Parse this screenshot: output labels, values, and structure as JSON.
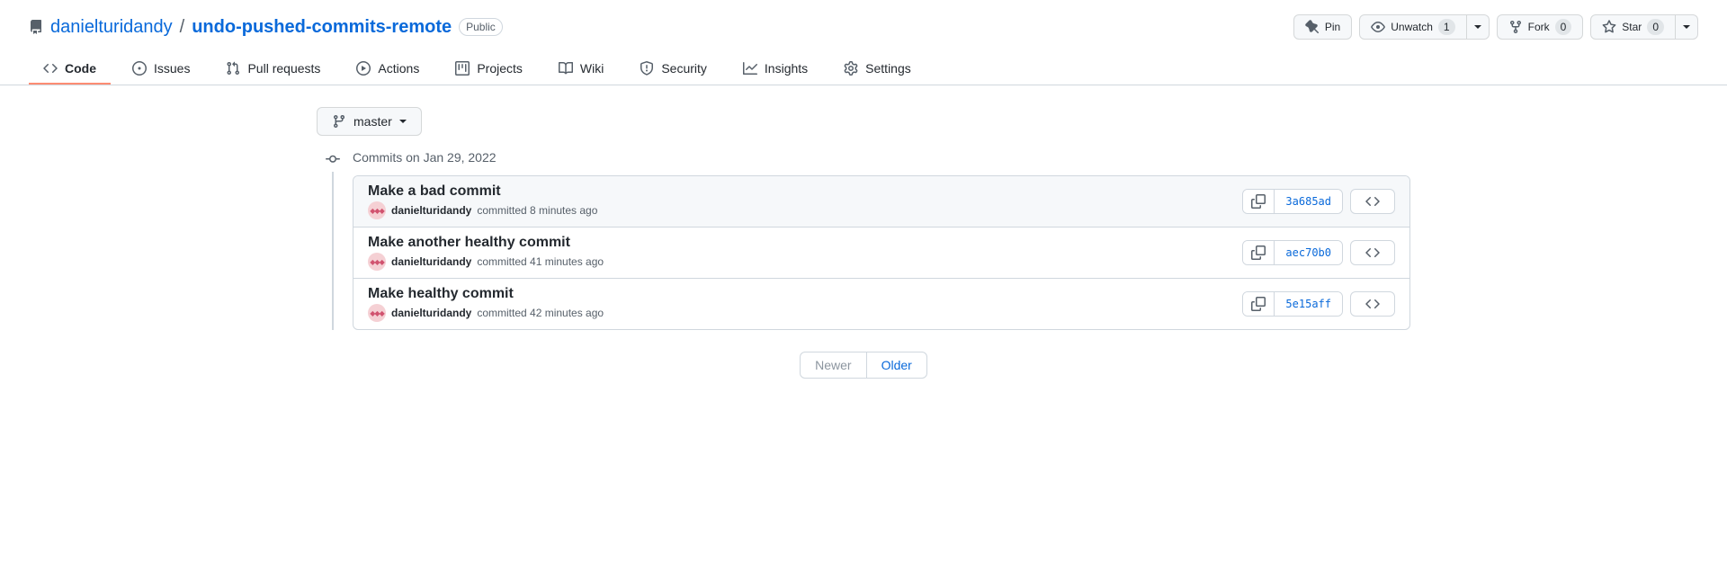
{
  "repo": {
    "owner": "danielturidandy",
    "name": "undo-pushed-commits-remote",
    "visibility": "Public"
  },
  "actions": {
    "pin": "Pin",
    "unwatch": "Unwatch",
    "unwatch_count": "1",
    "fork": "Fork",
    "fork_count": "0",
    "star": "Star",
    "star_count": "0"
  },
  "tabs": {
    "code": "Code",
    "issues": "Issues",
    "pulls": "Pull requests",
    "actions": "Actions",
    "projects": "Projects",
    "wiki": "Wiki",
    "security": "Security",
    "insights": "Insights",
    "settings": "Settings"
  },
  "branch": "master",
  "commits_date_header": "Commits on Jan 29, 2022",
  "commits": [
    {
      "message": "Make a bad commit",
      "author": "danielturidandy",
      "committed_text": "committed 8 minutes ago",
      "sha": "3a685ad"
    },
    {
      "message": "Make another healthy commit",
      "author": "danielturidandy",
      "committed_text": "committed 41 minutes ago",
      "sha": "aec70b0"
    },
    {
      "message": "Make healthy commit",
      "author": "danielturidandy",
      "committed_text": "committed 42 minutes ago",
      "sha": "5e15aff"
    }
  ],
  "pagination": {
    "newer": "Newer",
    "older": "Older"
  }
}
